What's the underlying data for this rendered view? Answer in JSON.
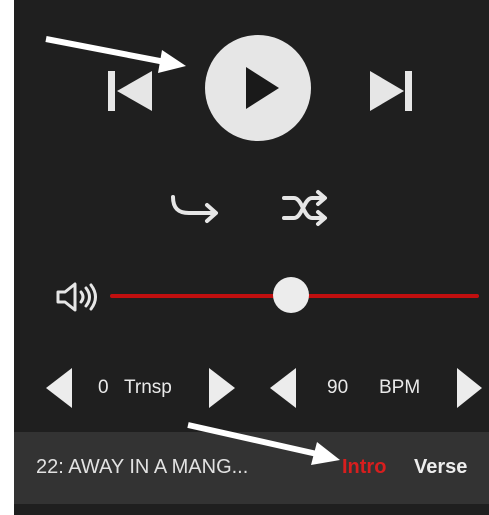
{
  "player": {
    "icons": {
      "play": "play-icon",
      "previous": "skip-previous-icon",
      "next": "skip-next-icon",
      "repeat": "repeat-arrow-icon",
      "shuffle": "shuffle-icon",
      "volume": "volume-icon"
    },
    "volume_level": 0.49
  },
  "transpose": {
    "value": "0",
    "label": "Trnsp"
  },
  "tempo": {
    "value": "90",
    "label": "BPM"
  },
  "song": {
    "title": "22: AWAY IN A MANG...",
    "sections": [
      {
        "label": "Intro",
        "active": true
      },
      {
        "label": "Verse",
        "active": false
      }
    ]
  },
  "colors": {
    "panel": "#1f1f1f",
    "song_bar": "#333333",
    "accent_red": "#c00f0f",
    "active_section": "#d81e1e",
    "control_light": "#e6e6e6",
    "annotation_arrow": "#ffffff"
  }
}
